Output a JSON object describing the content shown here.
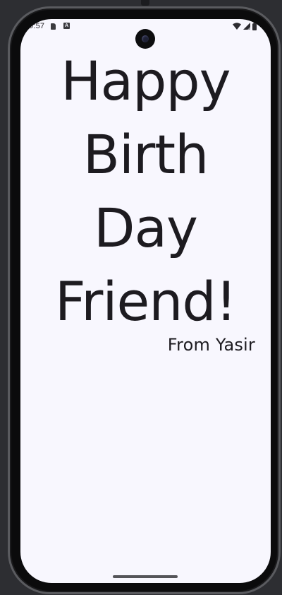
{
  "status_bar": {
    "time": "9:57",
    "icons": [
      "sd-card-icon",
      "accessibility-a-icon",
      "wifi-icon",
      "cell-signal-icon",
      "battery-icon"
    ]
  },
  "card": {
    "greeting_lines": [
      "Happy",
      "Birth",
      "Day",
      "Friend!"
    ],
    "signature": "From Yasir"
  },
  "colors": {
    "background": "#f8f7fe",
    "text": "#1d1b20",
    "frame": "#0b0b0c"
  }
}
